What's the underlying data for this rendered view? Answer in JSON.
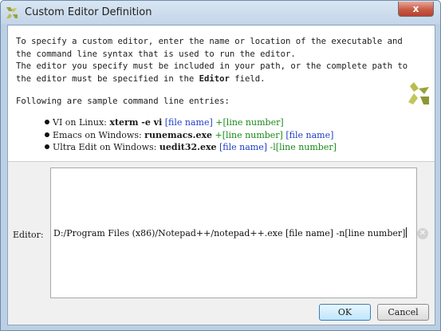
{
  "window": {
    "title": "Custom Editor Definition",
    "close_label": "x"
  },
  "info": {
    "line1": "To specify a custom editor, enter the name or location of the executable and",
    "line2": "the command line syntax that is used to run the editor.",
    "line3": "The editor you specify must be included in your path, or the complete path to",
    "line4_prefix": "the editor must be specified in the ",
    "line4_bold": "Editor",
    "line4_suffix": " field.",
    "samples_heading": "Following are sample command line entries:"
  },
  "samples": [
    {
      "label": "VI on Linux: ",
      "command": "xterm -e vi",
      "args_blue": " [file name]",
      "args_green": " +[line number]"
    },
    {
      "label": "Emacs on Windows: ",
      "command": "runemacs.exe",
      "args_green": " +[line number]",
      "args_blue": " [file name]"
    },
    {
      "label": "Ultra Edit on Windows: ",
      "command": "uedit32.exe",
      "args_blue": " [file name]",
      "args_green": " -l[line number]"
    }
  ],
  "editor": {
    "label": "Editor:",
    "value": "D:/Program Files (x86)/Notepad++/notepad++.exe [file name] -n[line number]"
  },
  "buttons": {
    "ok": "OK",
    "cancel": "Cancel"
  },
  "colors": {
    "arg_blue": "#1f3ec4",
    "arg_green": "#188a18",
    "logo_green": "#9aa23a"
  },
  "icons": {
    "app": "xilinx-logo-icon",
    "brand": "xilinx-logo-icon",
    "clear": "clear-field-icon"
  }
}
